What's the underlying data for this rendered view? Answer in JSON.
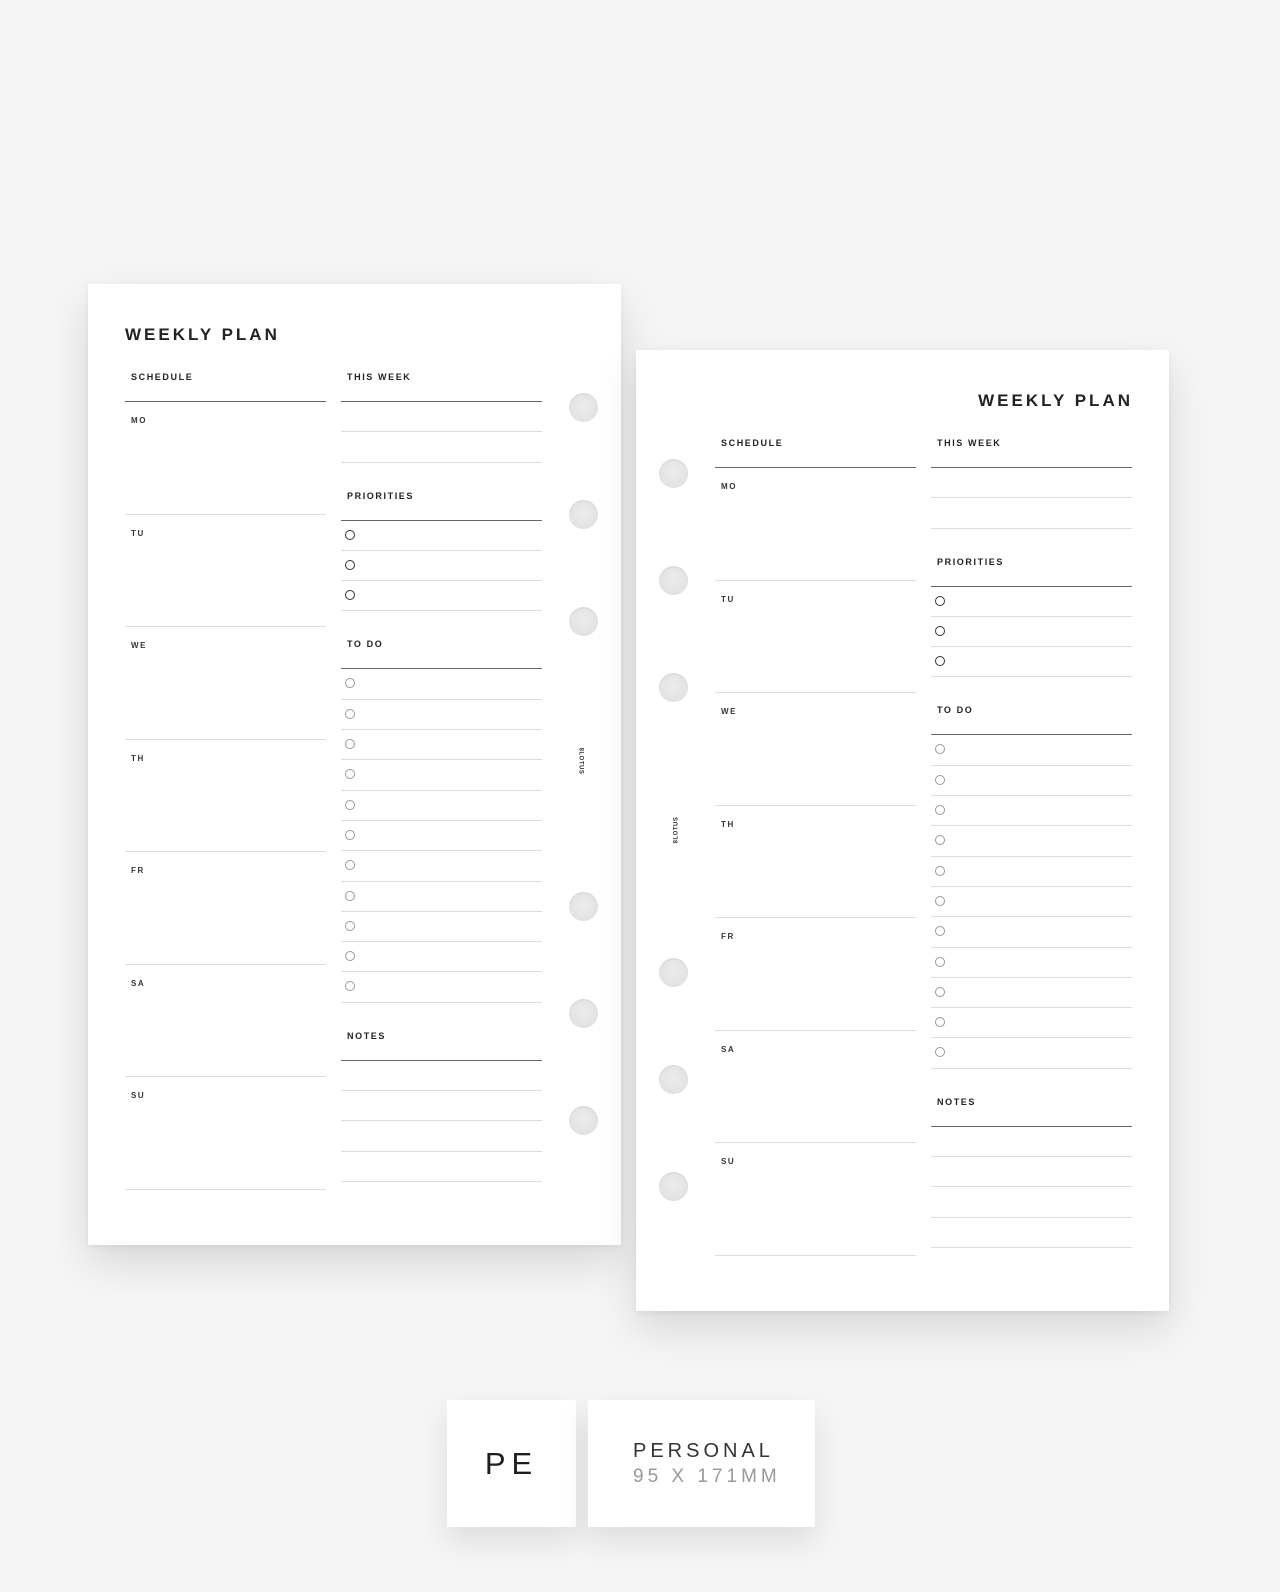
{
  "pages": [
    {
      "side": "left",
      "title": "WEEKLY PLAN",
      "brand": "8LOTUS",
      "schedule": {
        "label": "SCHEDULE",
        "days": [
          "MO",
          "TU",
          "WE",
          "TH",
          "FR",
          "SA",
          "SU"
        ]
      },
      "this_week": {
        "label": "THIS WEEK",
        "lines": 2
      },
      "priorities": {
        "label": "PRIORITIES",
        "items": 3
      },
      "todo": {
        "label": "TO DO",
        "items": 11
      },
      "notes": {
        "label": "NOTES",
        "lines": 4
      }
    },
    {
      "side": "right",
      "title": "WEEKLY PLAN",
      "brand": "8LOTUS",
      "schedule": {
        "label": "SCHEDULE",
        "days": [
          "MO",
          "TU",
          "WE",
          "TH",
          "FR",
          "SA",
          "SU"
        ]
      },
      "this_week": {
        "label": "THIS WEEK",
        "lines": 2
      },
      "priorities": {
        "label": "PRIORITIES",
        "items": 3
      },
      "todo": {
        "label": "TO DO",
        "items": 11
      },
      "notes": {
        "label": "NOTES",
        "lines": 4
      }
    }
  ],
  "size_info": {
    "code": "PE",
    "name": "PERSONAL",
    "dimensions": "95 X 171MM"
  }
}
